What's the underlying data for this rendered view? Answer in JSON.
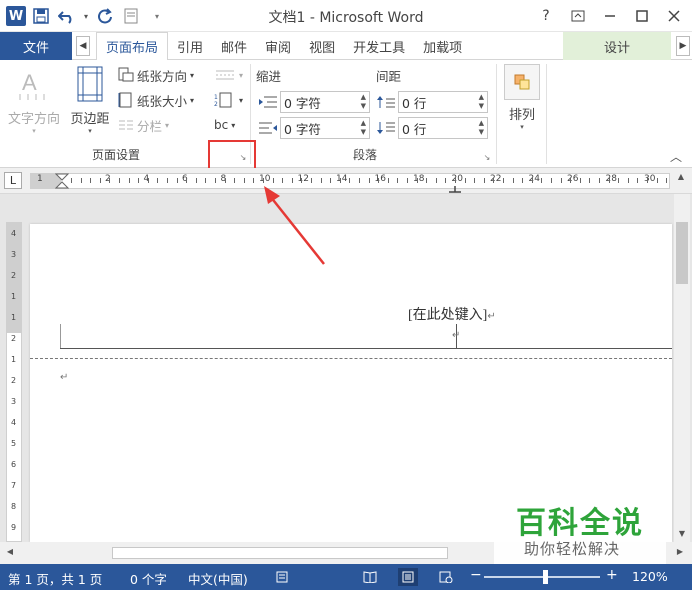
{
  "window": {
    "title": "文档1 - Microsoft Word",
    "help": "?",
    "app_icon_letter": "W"
  },
  "tabs": {
    "file": "文件",
    "items": [
      "页面布局",
      "引用",
      "邮件",
      "审阅",
      "视图",
      "开发工具",
      "加载项"
    ],
    "active": "页面布局",
    "contextual": "设计"
  },
  "ribbon": {
    "page_setup": {
      "text_direction": "文字方向",
      "margins": "页边距",
      "orientation": "纸张方向",
      "size": "纸张大小",
      "columns": "分栏",
      "hyphenation": "bc",
      "group_label": "页面设置"
    },
    "paragraph": {
      "indent_label": "缩进",
      "spacing_label": "间距",
      "indent_left": "0 字符",
      "indent_right": "0 字符",
      "spacing_before": "0 行",
      "spacing_after": "0 行",
      "group_label": "段落"
    },
    "arrange": {
      "label": "排列"
    }
  },
  "ruler": {
    "tab_selector": "L",
    "labels": [
      "1",
      "2",
      "4",
      "6",
      "8",
      "10",
      "12",
      "14",
      "16",
      "18",
      "20",
      "22",
      "24",
      "26",
      "28",
      "30"
    ],
    "vertical_labels": [
      "4",
      "3",
      "2",
      "1",
      "1",
      "2",
      "1",
      "2",
      "3",
      "4",
      "5",
      "6",
      "7",
      "8",
      "9"
    ]
  },
  "document": {
    "header_placeholder": "[在此处键入]",
    "para_mark": "↵"
  },
  "watermark": {
    "title": "百科全说",
    "subtitle": "助你轻松解决"
  },
  "status": {
    "page": "第 1 页，共 1 页",
    "words": "0 个字",
    "language": "中文(中国)",
    "zoom": "120%",
    "zoom_out": "−",
    "zoom_in": "+"
  },
  "colors": {
    "accent": "#2b579a",
    "design_tab": "#e2f0d9",
    "highlight": "#e53935",
    "watermark": "#2ea43a"
  }
}
